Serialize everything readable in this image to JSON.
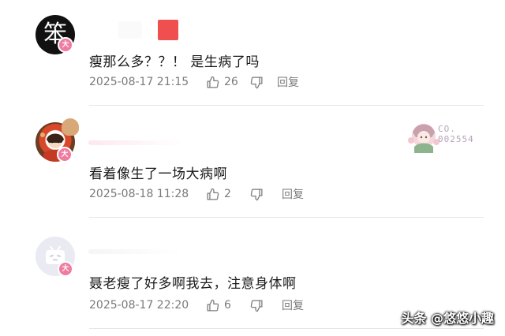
{
  "comments": [
    {
      "avatar_char": "笨",
      "level_badge": "大",
      "text": "瘦那么多？？！ 是生病了吗",
      "time": "2025-08-17 21:15",
      "likes": "26",
      "reply_label": "回复"
    },
    {
      "level_badge": "大",
      "text": "看着像生了一场大病啊",
      "time": "2025-08-18 11:28",
      "likes": "2",
      "reply_label": "回复",
      "decoration": {
        "line1": "CO.",
        "line2": "002554"
      }
    },
    {
      "level_badge": "大",
      "text": "聂老瘦了好多啊我去，注意身体啊",
      "time": "2025-08-17 22:20",
      "likes": "6",
      "reply_label": "回复"
    }
  ],
  "watermark": "头条 @悠悠小趣",
  "colors": {
    "badge_pink": "#f07aa0",
    "meta_gray": "#7a7a7a",
    "blur_red": "#ef4f4f"
  }
}
